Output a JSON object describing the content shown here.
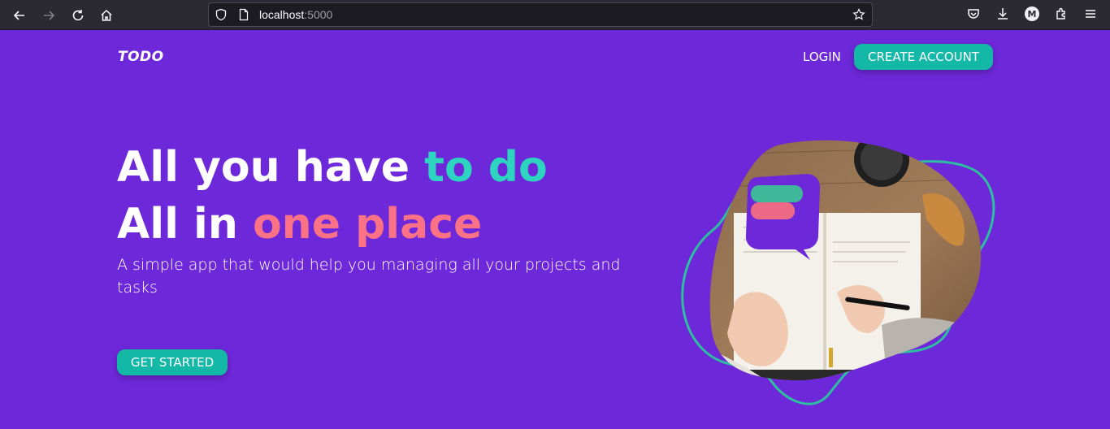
{
  "browser": {
    "url_host": "localhost",
    "url_port": ":5000",
    "profile_initial": "M"
  },
  "nav": {
    "logo": "TODO",
    "login_label": "LOGIN",
    "create_account_label": "CREATE ACCOUNT"
  },
  "hero": {
    "line1_plain": "All you have ",
    "line1_accent": "to do",
    "line2_plain": "All in ",
    "line2_accent": "one place",
    "subtitle": "A simple app that would help you managing all your projects and tasks",
    "cta_label": "GET STARTED"
  },
  "colors": {
    "background": "#6d28d9",
    "accent_teal": "#14b8a6",
    "accent_pink": "#fb7185"
  }
}
